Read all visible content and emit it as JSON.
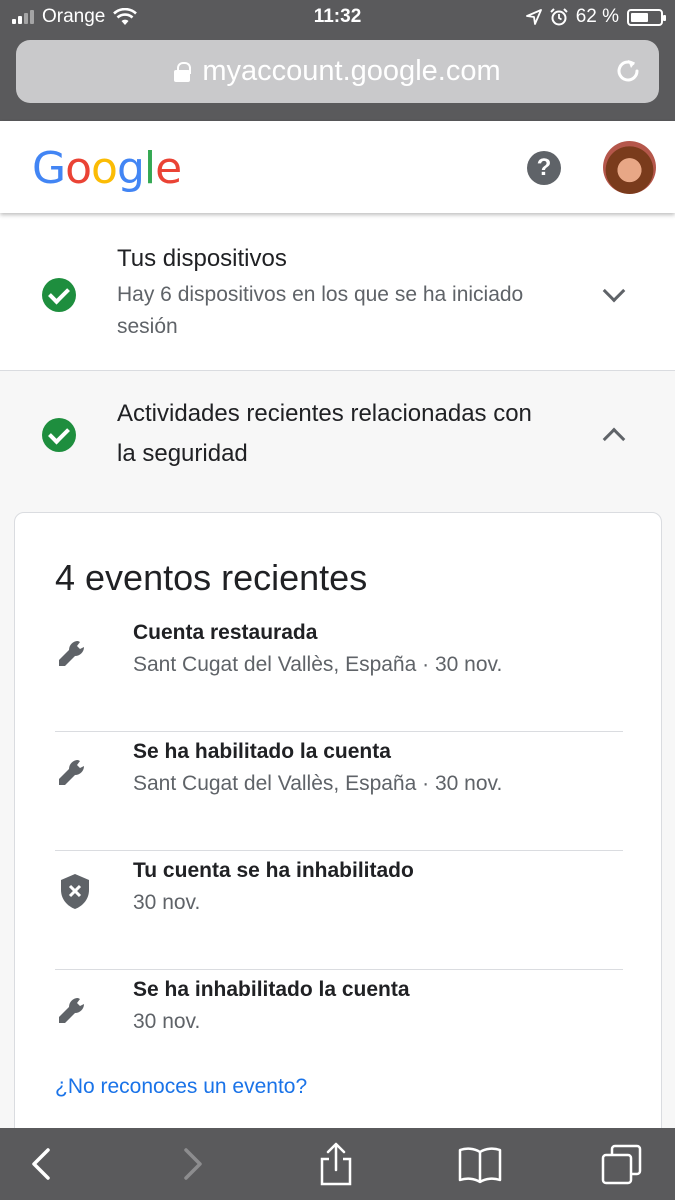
{
  "status_bar": {
    "carrier": "Orange",
    "time": "11:32",
    "battery": "62 %",
    "battery_level": 0.62
  },
  "browser": {
    "url": "myaccount.google.com",
    "icons": [
      "lock-icon",
      "reload-icon"
    ]
  },
  "header": {
    "logo_letters": [
      "G",
      "o",
      "o",
      "g",
      "l",
      "e"
    ],
    "help_label": "?",
    "colors": {
      "blue": "#4285F4",
      "red": "#EA4335",
      "yellow": "#FBBC05",
      "green": "#34A853"
    }
  },
  "sections": [
    {
      "title": "Tus dispositivos",
      "subtitle": "Hay 6 dispositivos en los que se ha iniciado sesión",
      "status_icon": "check-circle-icon",
      "expand_icon": "chevron-down-icon"
    },
    {
      "title": "Actividades recientes relacionadas con la seguridad",
      "status_icon": "check-circle-icon",
      "expand_icon": "chevron-up-icon"
    }
  ],
  "events_card": {
    "title": "4 eventos recientes",
    "events": [
      {
        "title": "Cuenta restaurada",
        "subtitle": "Sant Cugat del Vallès, España · 30 nov.",
        "icon": "wrench-icon"
      },
      {
        "title": "Se ha habilitado la cuenta",
        "subtitle": "Sant Cugat del Vallès, España · 30 nov.",
        "icon": "wrench-icon"
      },
      {
        "title": "Tu cuenta se ha inhabilitado",
        "subtitle": "30 nov.",
        "icon": "shield-x-icon"
      },
      {
        "title": "Se ha inhabilitado la cuenta",
        "subtitle": "30 nov.",
        "icon": "wrench-icon"
      }
    ],
    "link": "¿No reconoces un evento?"
  },
  "toolbar": {
    "icons": [
      "back-icon",
      "forward-icon",
      "share-icon",
      "bookmarks-icon",
      "tabs-icon"
    ]
  },
  "accent_color": "#1e8e3e",
  "link_color": "#1a73e8"
}
